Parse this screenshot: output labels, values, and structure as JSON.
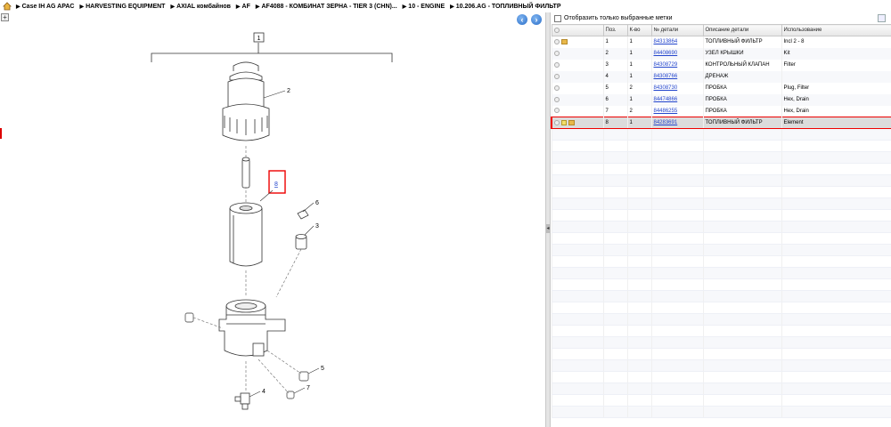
{
  "breadcrumb": [
    "Case IH AG APAC",
    "HARVESTING EQUIPMENT",
    "AXIAL комбайнов",
    "AF",
    "AF4088 - КОМБИНАТ ЗЕРНА - TIER 3 (CHN)...",
    "10 - ENGINE",
    "10.206.AG - ТОПЛИВНЫЙ ФИЛЬТР"
  ],
  "filter": {
    "label": "Отобразить только выбранные метки"
  },
  "table": {
    "headers": [
      "",
      "Поз.",
      "К-во",
      "№ детали",
      "Описание детали",
      "Использование"
    ],
    "rows": [
      {
        "pos": "1",
        "qty": "1",
        "part": "84313864",
        "desc": "ТОПЛИВНЫЙ ФИЛЬТР",
        "usage": "Incl 2 - 8",
        "icons": [
          "package"
        ]
      },
      {
        "pos": "2",
        "qty": "1",
        "part": "84408690",
        "desc": "УЗЕЛ КРЫШКИ",
        "usage": "Kit",
        "icons": []
      },
      {
        "pos": "3",
        "qty": "1",
        "part": "84308729",
        "desc": "КОНТРОЛЬНЫЙ КЛАПАН",
        "usage": "Filter",
        "icons": []
      },
      {
        "pos": "4",
        "qty": "1",
        "part": "84308766",
        "desc": "ДРЕНАЖ",
        "usage": "",
        "icons": []
      },
      {
        "pos": "5",
        "qty": "2",
        "part": "84308730",
        "desc": "ПРОБКА",
        "usage": "Plug, Filter",
        "icons": []
      },
      {
        "pos": "6",
        "qty": "1",
        "part": "84474866",
        "desc": "ПРОБКА",
        "usage": "Hex, Drain",
        "icons": []
      },
      {
        "pos": "7",
        "qty": "2",
        "part": "84486255",
        "desc": "ПРОБКА",
        "usage": "Hex, Drain",
        "icons": []
      },
      {
        "pos": "8",
        "qty": "1",
        "part": "84283691",
        "desc": "ТОПЛИВНЫЙ ФИЛЬТР",
        "usage": "Element",
        "icons": [
          "note",
          "package"
        ],
        "selected": true
      }
    ]
  },
  "diagram": {
    "callouts": [
      "1",
      "2",
      "3",
      "4",
      "5",
      "6",
      "7",
      "8"
    ]
  }
}
